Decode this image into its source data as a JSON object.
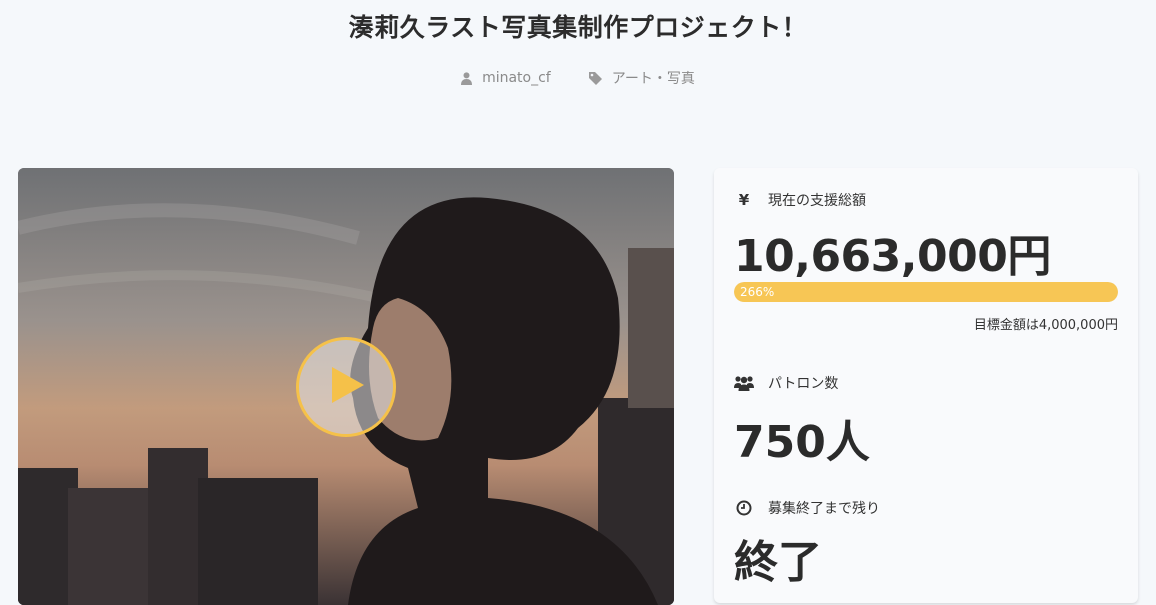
{
  "project": {
    "title": "湊莉久ラスト写真集制作プロジェクト！",
    "owner": "minato_cf",
    "category": "アート・写真"
  },
  "icons": {
    "owner": "user-icon",
    "category": "tag-icon",
    "amount": "yen-icon",
    "patrons": "users-icon",
    "remaining": "clock-icon",
    "video": "play-icon"
  },
  "colors": {
    "accent": "#f7c655",
    "play_ring": "#f5c149"
  },
  "stats": {
    "amount_label": "現在の支援総額",
    "amount_icon_glyph": "¥",
    "amount_value": "10,663,000円",
    "progress_text": "266%",
    "progress_fraction": 1.0,
    "goal_text": "目標金額は4,000,000円",
    "patrons_label": "パトロン数",
    "patrons_value": "750人",
    "remaining_label": "募集終了まで残り",
    "remaining_value": "終了"
  }
}
